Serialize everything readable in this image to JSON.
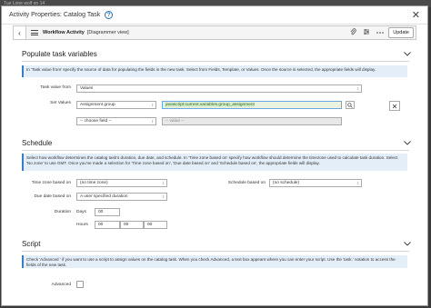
{
  "background": {
    "text": "Tue  Lone wolf on 14"
  },
  "dialog": {
    "title": "Activity Properties: Catalog Task",
    "help_icon": "?",
    "close_icon": "✕"
  },
  "toolbar": {
    "back_icon": "‹",
    "label": "Workflow Activity",
    "sub": "[Diagrammer view]",
    "icons": [
      "paperclip-icon",
      "sliders-icon",
      "more-icon"
    ],
    "update_label": "Update"
  },
  "populate": {
    "title": "Populate task variables",
    "info": "In 'Task value from' specify the source of data for populating the fields in the new task. Select from Fields, Template, or Values. Once the source is selected, the appropriate fields will display.",
    "task_value_label": "Task value from",
    "task_value": "Values",
    "set_values_label": "Set Values",
    "field_select": "Assignment group",
    "value_input": "javascript:current.variables.group_assignment",
    "choose_field": "-- choose field --",
    "value_placeholder": "-- value --"
  },
  "schedule": {
    "title": "Schedule",
    "info": "Select how workflow determines the catalog task's duration, due date, and schedule. In 'Time zone based on' specify how workflow should determine the timezone used to calculate task duration. Select 'No zone' to use GMT. Once you've made a selection for 'Time zone based on', 'Due date based on' and 'Schedule based on', the appropriate fields will display.",
    "tz_label": "Time zone based on",
    "tz_value": "(no time zone)",
    "sched_label": "Schedule based on",
    "sched_value": "(no schedule)",
    "due_label": "Due date based on",
    "due_value": "A user specified duration",
    "duration_label": "Duration",
    "days_label": "Days",
    "days_value": "00",
    "hours_label": "Hours",
    "hours_value": [
      "00",
      "00",
      "00"
    ]
  },
  "script": {
    "title": "Script",
    "info": "Check 'Advanced ' if you want to use a script to assign values on the catalog task. When you check Advanced, a text box appears where you can enter your script. Use the 'task.' notation to access the fields of the new task.",
    "advanced_label": "Advanced"
  }
}
